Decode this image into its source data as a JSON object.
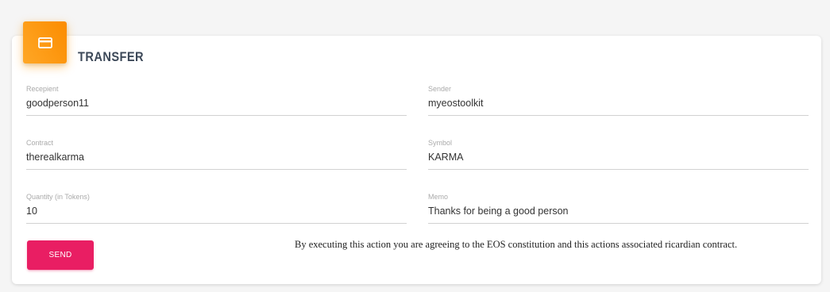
{
  "card": {
    "icon": "credit-card-icon",
    "title": "TRANSFER",
    "accent_color": "#ff9800"
  },
  "form": {
    "recipient": {
      "label": "Recepient",
      "value": "goodperson11"
    },
    "sender": {
      "label": "Sender",
      "value": "myeostoolkit"
    },
    "contract": {
      "label": "Contract",
      "value": "therealkarma"
    },
    "symbol": {
      "label": "Symbol",
      "value": "KARMA"
    },
    "quantity": {
      "label": "Quantity (in Tokens)",
      "value": "10"
    },
    "memo": {
      "label": "Memo",
      "value": "Thanks for being a good person"
    }
  },
  "actions": {
    "send_label": "SEND",
    "send_color": "#e91e63"
  },
  "disclaimer": "By executing this action you are agreeing to the EOS constitution and this actions associated ricardian contract."
}
